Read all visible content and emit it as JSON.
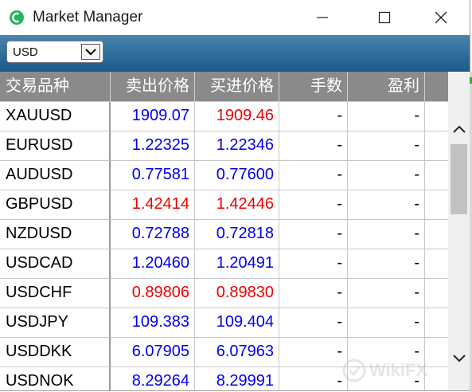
{
  "window": {
    "title": "Market Manager",
    "app_icon": "app-logo-icon",
    "controls": [
      "minimize-icon",
      "maximize-icon",
      "close-icon"
    ]
  },
  "toolbar": {
    "currency_select": {
      "value": "USD",
      "icon": "chevron-down-icon"
    }
  },
  "table": {
    "columns": [
      "交易品种",
      "卖出价格",
      "买进价格",
      "手数",
      "盈利"
    ],
    "rows": [
      {
        "symbol": "XAUUSD",
        "bid": "1909.07",
        "ask": "1909.46",
        "lots": "-",
        "profit": "-",
        "bid_color": "#0000ee",
        "ask_color": "#ee0000"
      },
      {
        "symbol": "EURUSD",
        "bid": "1.22325",
        "ask": "1.22346",
        "lots": "-",
        "profit": "-",
        "bid_color": "#0000ee",
        "ask_color": "#0000ee"
      },
      {
        "symbol": "AUDUSD",
        "bid": "0.77581",
        "ask": "0.77600",
        "lots": "-",
        "profit": "-",
        "bid_color": "#0000ee",
        "ask_color": "#0000ee"
      },
      {
        "symbol": "GBPUSD",
        "bid": "1.42414",
        "ask": "1.42446",
        "lots": "-",
        "profit": "-",
        "bid_color": "#ee0000",
        "ask_color": "#ee0000"
      },
      {
        "symbol": "NZDUSD",
        "bid": "0.72788",
        "ask": "0.72818",
        "lots": "-",
        "profit": "-",
        "bid_color": "#0000ee",
        "ask_color": "#0000ee"
      },
      {
        "symbol": "USDCAD",
        "bid": "1.20460",
        "ask": "1.20491",
        "lots": "-",
        "profit": "-",
        "bid_color": "#0000ee",
        "ask_color": "#0000ee"
      },
      {
        "symbol": "USDCHF",
        "bid": "0.89806",
        "ask": "0.89830",
        "lots": "-",
        "profit": "-",
        "bid_color": "#ee0000",
        "ask_color": "#ee0000"
      },
      {
        "symbol": "USDJPY",
        "bid": "109.383",
        "ask": "109.404",
        "lots": "-",
        "profit": "-",
        "bid_color": "#0000ee",
        "ask_color": "#0000ee"
      },
      {
        "symbol": "USDDKK",
        "bid": "6.07905",
        "ask": "6.07963",
        "lots": "-",
        "profit": "-",
        "bid_color": "#0000ee",
        "ask_color": "#0000ee"
      },
      {
        "symbol": "USDNOK",
        "bid": "8.29264",
        "ask": "8.29991",
        "lots": "-",
        "profit": "-",
        "bid_color": "#0000ee",
        "ask_color": "#0000ee"
      }
    ]
  },
  "scrollbar": {
    "up_icon": "scroll-up-icon",
    "down_icon": "scroll-down-icon"
  },
  "watermark": {
    "text": "WikiFX"
  }
}
